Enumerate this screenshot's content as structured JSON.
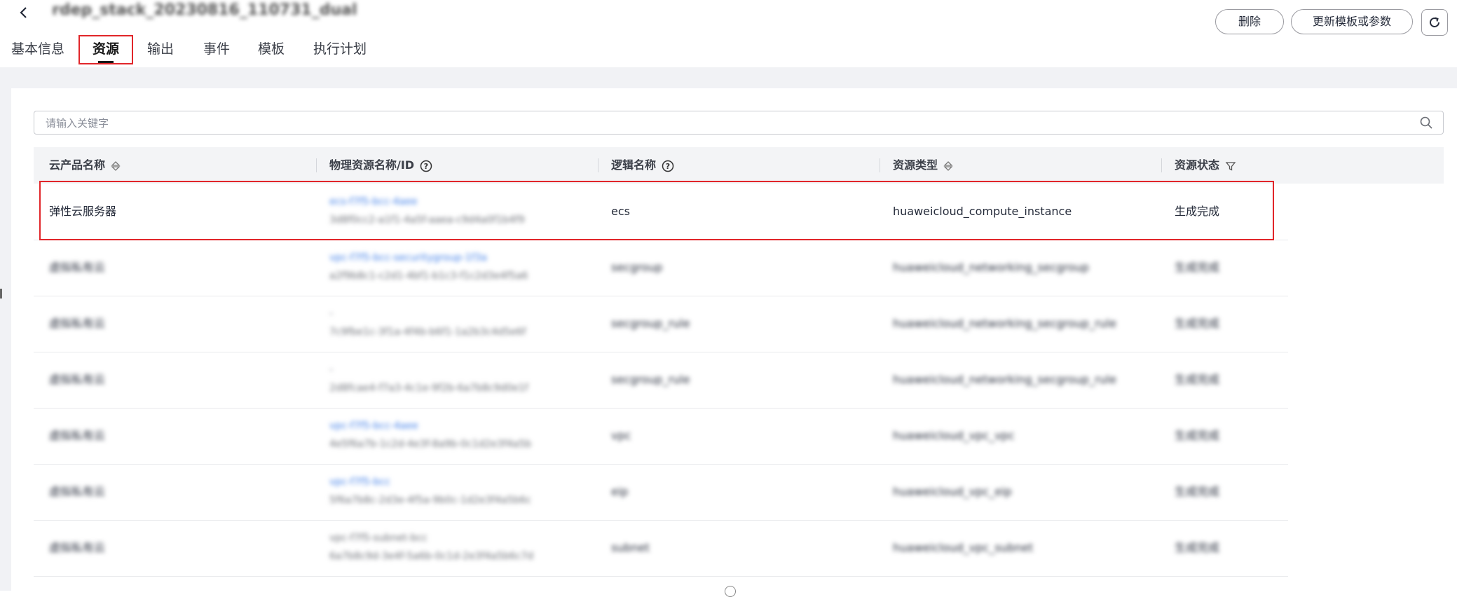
{
  "header": {
    "stack_name": "rdep_stack_20230816_110731_dual",
    "tabs": [
      {
        "label": "基本信息"
      },
      {
        "label": "资源"
      },
      {
        "label": "输出"
      },
      {
        "label": "事件"
      },
      {
        "label": "模板"
      },
      {
        "label": "执行计划"
      }
    ],
    "active_tab": "资源",
    "delete_label": "删除",
    "update_label": "更新模板或参数"
  },
  "search": {
    "placeholder": "请输入关键字",
    "value": ""
  },
  "table": {
    "columns": [
      {
        "label": "云产品名称"
      },
      {
        "label": "物理资源名称/ID"
      },
      {
        "label": "逻辑名称"
      },
      {
        "label": "资源类型"
      },
      {
        "label": "资源状态"
      }
    ],
    "rows": [
      {
        "product": "弹性云服务器",
        "physical_name": "ecs-f7f5-bcc-4aee",
        "physical_id": "3d8f0cc2-a1f1-4a5f-aaea-c9d4a0f1b4f9",
        "logical": "ecs",
        "type": "huaweicloud_compute_instance",
        "status": "生成完成"
      },
      {
        "product": "虚拟私有云",
        "physical_name": "vpc-f7f5-bcc-securitygroup-1f3a",
        "physical_id": "a2f9b8c1-c2d1-4bf1-b1c3-f1c2d3e4f5a6",
        "logical": "secgroup",
        "type": "huaweicloud_networking_secgroup",
        "status": "生成完成"
      },
      {
        "product": "虚拟私有云",
        "physical_name": "-",
        "physical_id": "7c9fbe1c-3f1a-4f4b-b6f1-1a2b3c4d5e6f",
        "logical": "secgroup_rule",
        "type": "huaweicloud_networking_secgroup_rule",
        "status": "生成完成"
      },
      {
        "product": "虚拟私有云",
        "physical_name": "-",
        "physical_id": "2d8fcae4-f7a3-4c1e-9f2b-6a7b8c9d0e1f",
        "logical": "secgroup_rule",
        "type": "huaweicloud_networking_secgroup_rule",
        "status": "生成完成"
      },
      {
        "product": "虚拟私有云",
        "physical_name": "vpc-f7f5-bcc-4aee",
        "physical_id": "4e5f6a7b-1c2d-4e3f-8a9b-0c1d2e3f4a5b",
        "logical": "vpc",
        "type": "huaweicloud_vpc_vpc",
        "status": "生成完成"
      },
      {
        "product": "虚拟私有云",
        "physical_name": "vpc-f7f5-bcc",
        "physical_id": "5f6a7b8c-2d3e-4f5a-9b0c-1d2e3f4a5b6c",
        "logical": "eip",
        "type": "huaweicloud_vpc_eip",
        "status": "生成完成"
      },
      {
        "product": "虚拟私有云",
        "physical_name": "vpc-f7f5-subnet-bcc",
        "physical_id": "6a7b8c9d-3e4f-5a6b-0c1d-2e3f4a5b6c7d",
        "logical": "subnet",
        "type": "huaweicloud_vpc_subnet",
        "status": "生成完成"
      }
    ]
  }
}
